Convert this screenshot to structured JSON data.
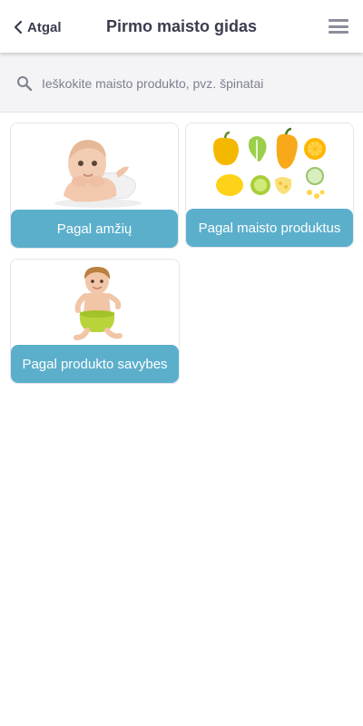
{
  "header": {
    "back_label": "Atgal",
    "title": "Pirmo maisto gidas"
  },
  "search": {
    "placeholder": "Ieškokite maisto produkto, pvz. špinatai",
    "value": ""
  },
  "categories": [
    {
      "label": "Pagal amžių",
      "image": "baby-lying-photo"
    },
    {
      "label": "Pagal maisto produktus",
      "image": "yellow-vegetables-photo"
    },
    {
      "label": "Pagal produkto savybes",
      "image": "toddler-on-potty-photo"
    }
  ],
  "colors": {
    "accent": "#5bafcb",
    "text": "#3a3d4e",
    "search_bg": "#f4f4f6"
  }
}
